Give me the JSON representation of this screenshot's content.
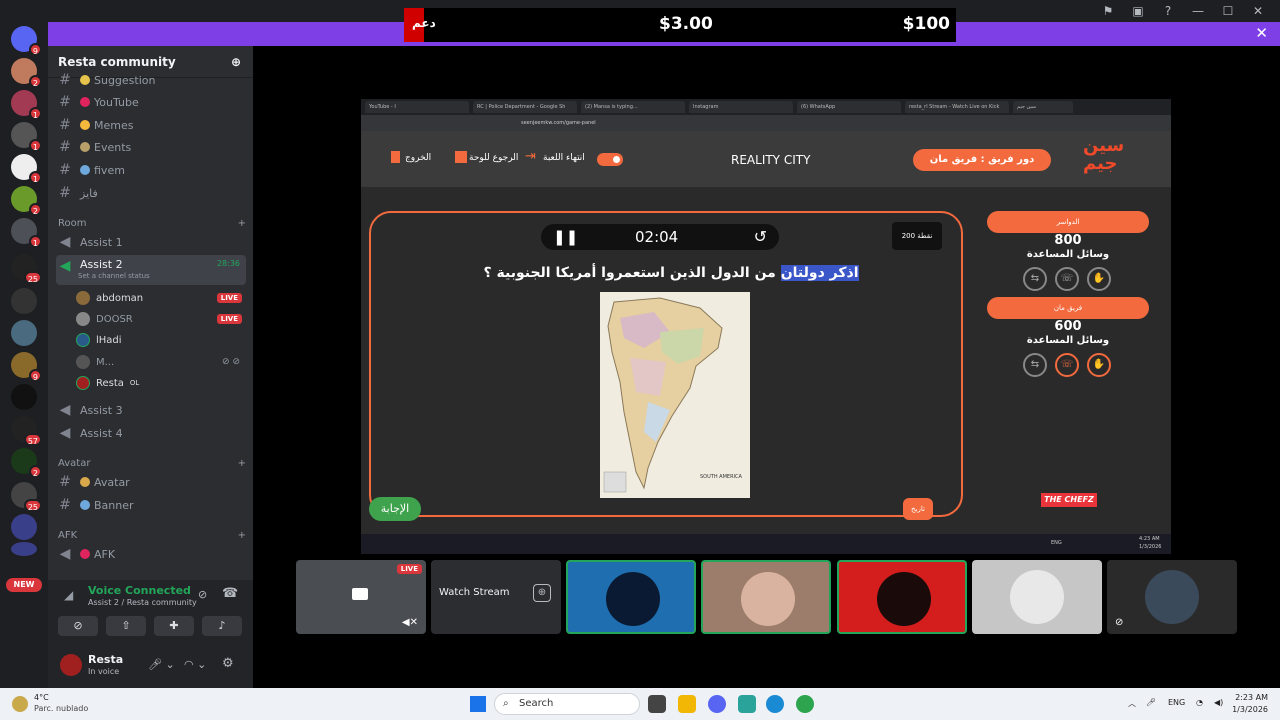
{
  "overlay": {
    "left_text": "دعم",
    "mid_amount": "$3.00",
    "right_amount": "$100"
  },
  "server": {
    "name": "Resta community",
    "rail_badges": [
      "9",
      "2",
      "1",
      "1",
      "1",
      "2",
      "1",
      "25",
      "",
      "",
      "9",
      "",
      "57",
      "2",
      "25",
      ""
    ],
    "new_label": "NEW"
  },
  "channels": [
    {
      "name": "Suggestion"
    },
    {
      "name": "YouTube"
    },
    {
      "name": "Memes"
    },
    {
      "name": "Events"
    },
    {
      "name": "fivem"
    },
    {
      "name": "فايز"
    }
  ],
  "categories": {
    "room": "Room",
    "avatar": "Avatar",
    "afk": "AFK"
  },
  "voice_channels": {
    "assist1": "Assist 1",
    "assist2": "Assist 2",
    "assist2_time": "28:36",
    "assist2_status": "Set a channel status",
    "assist3": "Assist 3",
    "assist4": "Assist 4",
    "afk": "AFK"
  },
  "members": [
    {
      "name": "abdoman",
      "live": "LIVE"
    },
    {
      "name": "DOOSR",
      "live": "LIVE"
    },
    {
      "name": "lHadi",
      "live": ""
    },
    {
      "name": "M...",
      "live": ""
    },
    {
      "name": "Resta",
      "live": "",
      "extra": "OL"
    }
  ],
  "avatar_channels": [
    "Avatar",
    "Banner"
  ],
  "voice": {
    "status": "Voice Connected",
    "location": "Assist 2 / Resta community"
  },
  "user": {
    "name": "Resta",
    "status": "In voice"
  },
  "browser": {
    "tabs": [
      "YouTube - I",
      "RC | Police Department - Google Sh",
      "(2) Mansa is typing...",
      "Instagram",
      "(6) WhatsApp",
      "resta_rl Stream - Watch Live on Kick",
      "سين جيم"
    ],
    "url": "seenjeemkw.com/game-panel"
  },
  "game": {
    "exit": "الخروج",
    "back_board": "الرجوع للوحة",
    "end_game": "انتهاء اللعبة",
    "title": "REALITY CITY",
    "turn_label": "دور فريق : فريق مان",
    "logo_line1": "سين",
    "logo_line2": "جيم",
    "timer": "02:04",
    "points": "200 نقطة",
    "question_highlight": "اذكر دولتان",
    "question_rest": " من الدول الذين استعمروا أمريكا الجنوبية ؟",
    "map_caption": "SOUTH AMERICA",
    "answer": "الإجابة",
    "ask": "تاريخ",
    "teams": [
      {
        "name": "الدواسر",
        "score": "800",
        "help": "وسائل المساعدة"
      },
      {
        "name": "فريق مان",
        "score": "600",
        "help": "وسائل المساعدة"
      }
    ],
    "sponsor": "THE CHEFZ"
  },
  "inner_taskbar": {
    "time": "4:23 AM",
    "date": "1/3/2026",
    "lang": "ENG"
  },
  "tiles": {
    "live": "LIVE",
    "watch": "Watch Stream"
  },
  "taskbar": {
    "temp": "4°C",
    "weather": "Parc. nublado",
    "search": "Search",
    "lang": "ENG",
    "time": "2:23 AM",
    "date": "1/3/2026"
  },
  "colors": {
    "accent": "#f26a3d",
    "banner": "#7f3fe7",
    "voice_green": "#23a55a",
    "live_red": "#da373c"
  }
}
